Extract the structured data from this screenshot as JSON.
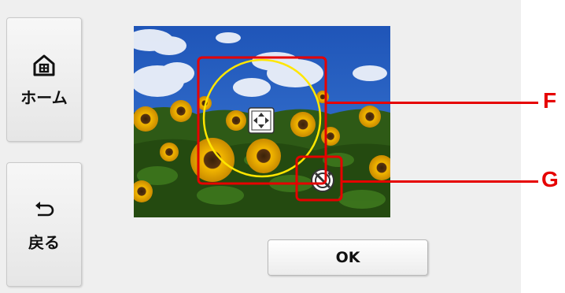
{
  "sidebar": {
    "home_label": "ホーム",
    "back_label": "戻る",
    "home_icon": "home-icon",
    "back_icon": "back-arrow-icon"
  },
  "preview": {
    "move_icon": "move-arrows-icon",
    "rotate_icon": "rotate-icon"
  },
  "buttons": {
    "ok_label": "OK"
  },
  "callouts": {
    "f_label": "F",
    "g_label": "G"
  },
  "colors": {
    "callout": "#e60000",
    "crop_circle": "#ffe600",
    "screen_bg": "#efefef"
  }
}
